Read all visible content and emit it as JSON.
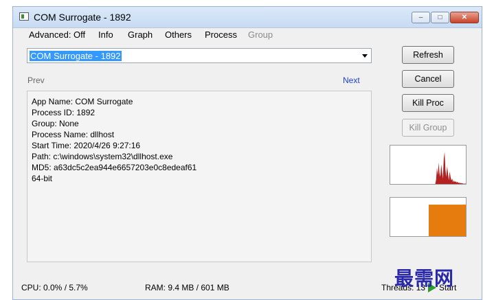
{
  "window": {
    "title": "COM Surrogate - 1892"
  },
  "window_controls": {
    "minimize": "–",
    "maximize": "□",
    "close": "✕"
  },
  "menu": [
    {
      "label": "Advanced: Off",
      "enabled": true
    },
    {
      "label": "Info",
      "enabled": true
    },
    {
      "label": "Graph",
      "enabled": true
    },
    {
      "label": "Others",
      "enabled": true
    },
    {
      "label": "Process",
      "enabled": true
    },
    {
      "label": "Group",
      "enabled": false
    }
  ],
  "process_select": {
    "value": "COM Surrogate - 1892"
  },
  "nav": {
    "prev": "Prev",
    "next": "Next"
  },
  "info": {
    "lines": [
      "App Name: COM Surrogate",
      "Process ID: 1892",
      "Group: None",
      "Process Name: dllhost",
      "Start Time: 2020/4/26 9:27:16",
      "Path: c:\\windows\\system32\\dllhost.exe",
      "MD5: a63dc5c2ea944e6657203e0c8edeaf61",
      "64-bit"
    ]
  },
  "buttons": {
    "refresh": "Refresh",
    "cancel": "Cancel",
    "kill_proc": "Kill Proc",
    "kill_group": "Kill Group"
  },
  "graphs": {
    "cpu": {
      "color": "#b22222",
      "values": [
        0,
        0,
        0,
        0,
        0,
        0,
        0,
        0,
        0,
        0,
        0,
        0,
        0,
        0,
        0,
        0,
        0,
        0,
        0,
        0,
        0,
        0,
        0,
        0,
        0,
        0,
        0,
        0,
        0,
        0,
        0,
        0,
        0,
        0,
        0,
        0,
        0,
        0,
        0,
        0,
        0,
        0,
        0,
        0,
        0,
        0,
        0,
        0,
        0,
        0,
        0,
        0,
        0,
        0,
        0.12,
        0.45,
        0.25,
        0.6,
        0.3,
        0.2,
        0.55,
        0.35,
        0.15,
        0.7,
        0.9,
        0.4,
        0.2,
        0.5,
        0.3,
        0.1,
        0.35,
        0.2,
        0.1,
        0.15,
        0.05,
        0.1,
        0.05,
        0.08,
        0.04,
        0.06,
        0.03,
        0.04,
        0.02,
        0.03,
        0.02,
        0.02,
        0.01,
        0.01,
        0.01,
        0.01
      ]
    },
    "ram": {
      "color": "#e57c0d",
      "fill_fraction": 0.82
    }
  },
  "status": {
    "cpu": "CPU: 0.0% / 5.7%",
    "ram": "RAM: 9.4 MB / 601 MB",
    "threads": "Threads: 13",
    "start": "Start"
  },
  "watermark": "最需网"
}
